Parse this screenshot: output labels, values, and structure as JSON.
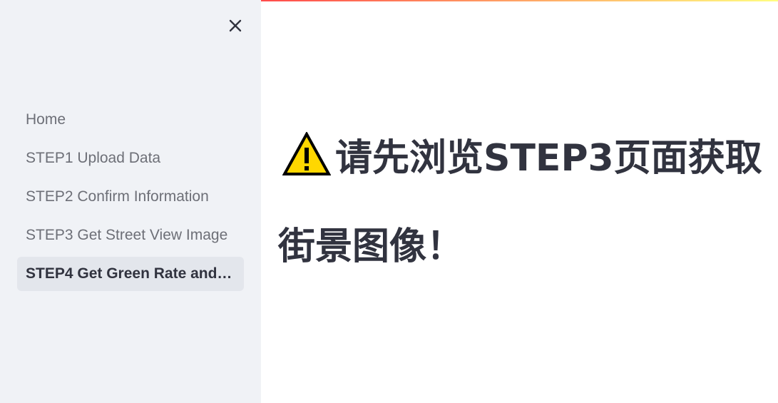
{
  "sidebar": {
    "close_label": "×",
    "items": [
      {
        "label": "Home"
      },
      {
        "label": "STEP1 Upload Data"
      },
      {
        "label": "STEP2 Confirm Information"
      },
      {
        "label": "STEP3 Get Street View Image"
      },
      {
        "label": "STEP4 Get Green Rate and…",
        "active": true
      }
    ]
  },
  "main": {
    "warning_icon": "warning-icon",
    "heading": "请先浏览STEP3页面获取街景图像！"
  },
  "colors": {
    "sidebar_bg": "#f0f2f6",
    "active_item_bg": "#e3e6ec",
    "text_primary": "#31333f",
    "text_muted": "#6d6f77",
    "accent_gradient_start": "#ff4b4b",
    "accent_gradient_end": "#fffd80",
    "warning_fill": "#ffd700"
  }
}
